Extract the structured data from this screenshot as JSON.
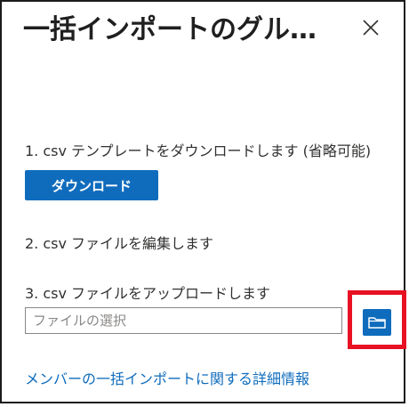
{
  "dialog": {
    "title": "一括インポートのグル…",
    "close_icon": "close-icon"
  },
  "steps": {
    "step1": "1. csv テンプレートをダウンロードします (省略可能)",
    "download_button": "ダウンロード",
    "step2": "2. csv ファイルを編集します",
    "step3": "3. csv ファイルをアップロードします"
  },
  "file_picker": {
    "placeholder": "ファイルの選択",
    "browse_icon": "folder-icon"
  },
  "link": {
    "label": "メンバーの一括インポートに関する詳細情報"
  },
  "colors": {
    "accent": "#0f6cbd",
    "highlight": "#e81123",
    "text": "#323130"
  }
}
